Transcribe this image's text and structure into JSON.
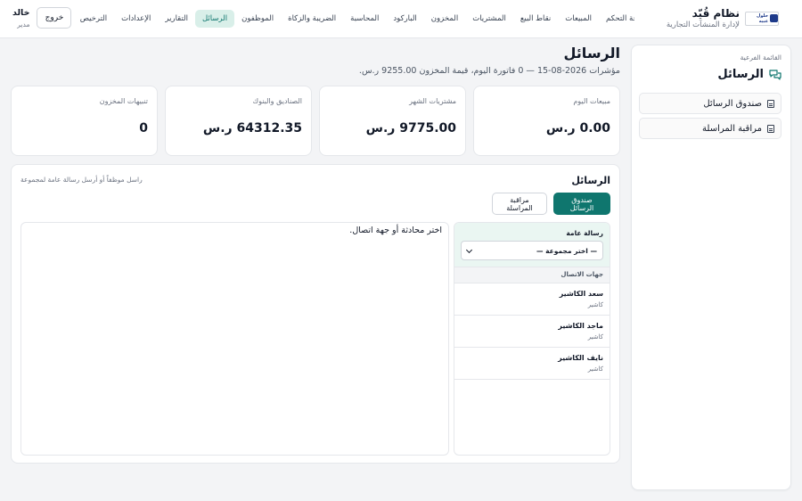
{
  "header": {
    "brand_title": "نظام قُيّد",
    "brand_subtitle": "لإدارة المنشآت التجارية",
    "logo_text": "حلول عبيه",
    "nav": [
      {
        "label": "لوحة التحكم",
        "active": false
      },
      {
        "label": "المبيعات",
        "active": false
      },
      {
        "label": "نقاط البيع",
        "active": false
      },
      {
        "label": "المشتريات",
        "active": false
      },
      {
        "label": "المخزون",
        "active": false
      },
      {
        "label": "الباركود",
        "active": false
      },
      {
        "label": "المحاسبة",
        "active": false
      },
      {
        "label": "الضريبة والزكاة",
        "active": false
      },
      {
        "label": "الموظفون",
        "active": false
      },
      {
        "label": "الرسائل",
        "active": true
      },
      {
        "label": "التقارير",
        "active": false
      },
      {
        "label": "الإعدادات",
        "active": false
      },
      {
        "label": "الترخيص",
        "active": false
      }
    ],
    "user_name": "خالد",
    "user_role": "مدير",
    "logout_label": "خروج"
  },
  "sidebar": {
    "caption": "القائمة الفرعية",
    "title": "الرسائل",
    "links": [
      "صندوق الرسائل",
      "مراقبة المراسلة"
    ]
  },
  "page": {
    "title": "الرسائل",
    "subtitle": "مؤشرات 2026-08-15 — 0 فاتورة اليوم، قيمة المخزون 9255.00 ر.س."
  },
  "stats": [
    {
      "label": "مبيعات اليوم",
      "value": "0.00 ر.س"
    },
    {
      "label": "مشتريات الشهر",
      "value": "9775.00 ر.س"
    },
    {
      "label": "الصناديق والبنوك",
      "value": "64312.35 ر.س"
    },
    {
      "label": "تنبيهات المخزون",
      "value": "0"
    }
  ],
  "messages": {
    "title": "الرسائل",
    "hint": "راسل موظفاً أو أرسل رسالة عامة لمجموعة",
    "tab_inbox": "صندوق الرسائل",
    "tab_monitor": "مراقبة المراسلة",
    "broadcast_label": "رسالة عامة",
    "group_select_value": "— اختر مجموعة —",
    "contacts_header": "جهات الاتصال",
    "contacts": [
      {
        "name": "سعد الكاشير",
        "role": "كاشير"
      },
      {
        "name": "ماجد الكاشير",
        "role": "كاشير"
      },
      {
        "name": "نايف الكاشير",
        "role": "كاشير"
      }
    ],
    "chat_placeholder": "اختر محادثة أو جهة اتصال."
  },
  "colors": {
    "accent": "#0f766e",
    "accent_light": "#d9efe9",
    "background": "#f3f4f6"
  }
}
